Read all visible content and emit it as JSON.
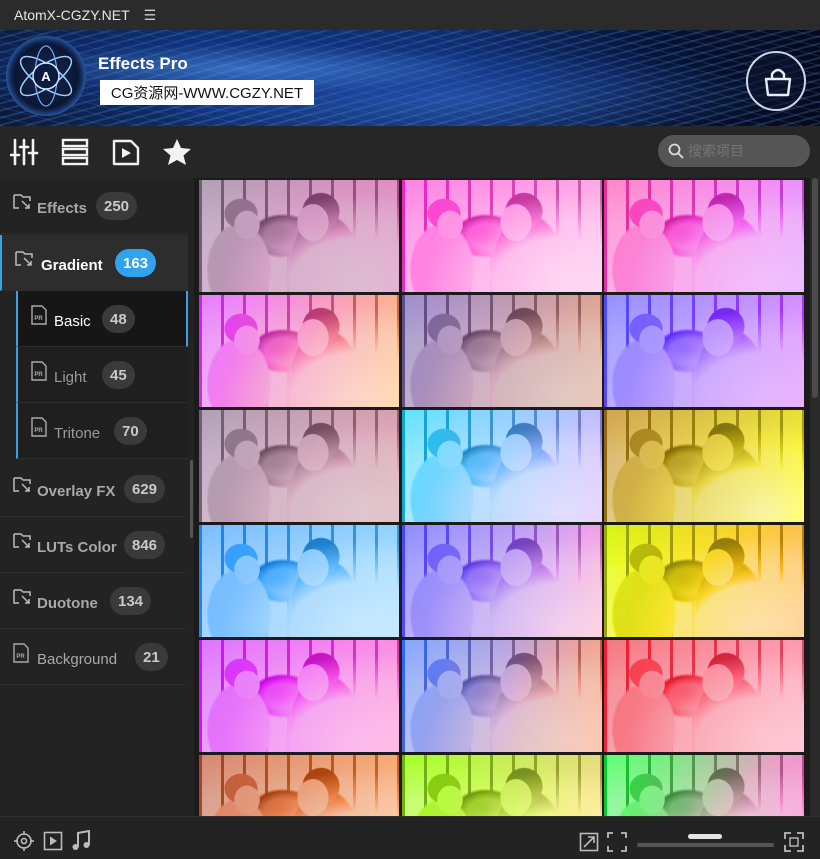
{
  "window": {
    "title": "AtomX-CGZY.NET",
    "menu_icon": "hamburger-icon"
  },
  "header": {
    "app_name": "Effects Pro",
    "watermark": "CG资源网-WWW.CGZY.NET",
    "logo_letter": "A",
    "cart_icon": "shopping-bag-icon"
  },
  "toolbar": {
    "icons": [
      "sliders-icon",
      "list-icon",
      "video-icon",
      "star-icon"
    ],
    "search_placeholder": "搜索项目"
  },
  "sidebar": {
    "categories": [
      {
        "label": "Effects",
        "count": "250"
      },
      {
        "label": "Gradient",
        "count": "163",
        "active": true
      },
      {
        "label": "Overlay FX",
        "count": "629"
      },
      {
        "label": "LUTs Color",
        "count": "846"
      },
      {
        "label": "Duotone",
        "count": "134"
      },
      {
        "label": "Background",
        "count": "21"
      }
    ],
    "subcategories": [
      {
        "label": "Basic",
        "count": "48",
        "selected": true
      },
      {
        "label": "Light",
        "count": "45"
      },
      {
        "label": "Tritone",
        "count": "70"
      }
    ]
  },
  "grid": {
    "tints": [
      [
        "#6b5c6f",
        "#b04a8a"
      ],
      [
        "#ff2fd0",
        "#ffb0e6"
      ],
      [
        "#ff3aa8",
        "#d060ff"
      ],
      [
        "#d020ff",
        "#ffb050"
      ],
      [
        "#3a2c70",
        "#c08060"
      ],
      [
        "#3030ff",
        "#d040ff"
      ],
      [
        "#6a5a70",
        "#b07080"
      ],
      [
        "#20d8ff",
        "#d0a0ff"
      ],
      [
        "#8a6010",
        "#ffff40"
      ],
      [
        "#2090ff",
        "#80d0ff"
      ],
      [
        "#2020ff",
        "#ffa0c0"
      ],
      [
        "#e0ff20",
        "#ffa020"
      ],
      [
        "#c000ff",
        "#ff60c0"
      ],
      [
        "#2060ff",
        "#ff8040"
      ],
      [
        "#e00010",
        "#ff80a0"
      ],
      [
        "#8a2a10",
        "#ff9040"
      ],
      [
        "#a0ff20",
        "#ffe0a0"
      ],
      [
        "#20ff40",
        "#ff40c0"
      ]
    ]
  },
  "bottombar": {
    "left_icons": [
      "target-icon",
      "play-icon",
      "music-icon"
    ],
    "right_icons": [
      "expand-icon",
      "fit-icon",
      "zoom-slider",
      "fullscreen-icon"
    ]
  }
}
